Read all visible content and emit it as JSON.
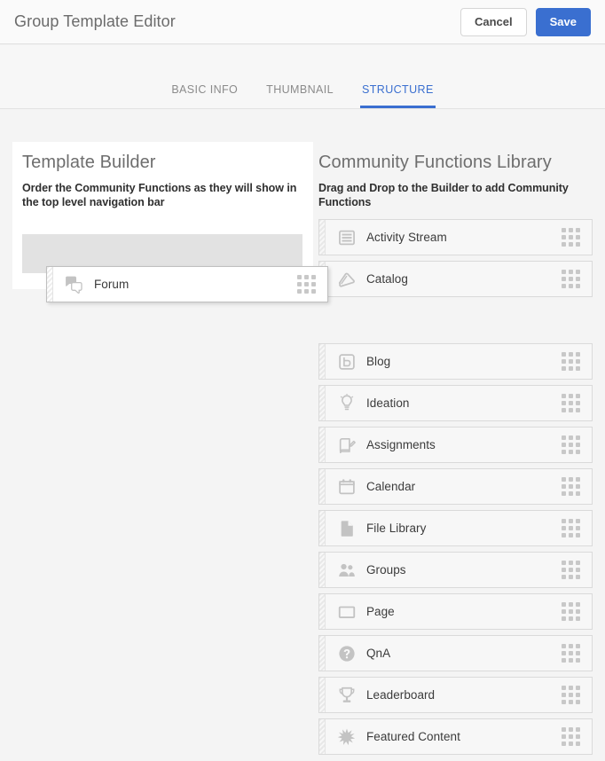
{
  "header": {
    "title": "Group Template Editor",
    "cancel_label": "Cancel",
    "save_label": "Save",
    "save_color": "#3a6fd0"
  },
  "tabs": [
    {
      "label": "BASIC INFO",
      "active": false
    },
    {
      "label": "THUMBNAIL",
      "active": false
    },
    {
      "label": "STRUCTURE",
      "active": true
    }
  ],
  "builder": {
    "title": "Template Builder",
    "description": "Order the Community Functions as they will show in the top level navigation bar",
    "placeholder_color": "#e2e2e2",
    "items": []
  },
  "library": {
    "title": "Community Functions Library",
    "description": "Drag and Drop to the Builder to add Community Functions",
    "items": [
      {
        "label": "Activity Stream",
        "icon": "activity-stream-icon",
        "gap_after": false
      },
      {
        "label": "Catalog",
        "icon": "catalog-icon",
        "gap_after": true
      },
      {
        "label": "Blog",
        "icon": "blog-icon",
        "gap_after": false
      },
      {
        "label": "Ideation",
        "icon": "lightbulb-icon",
        "gap_after": false
      },
      {
        "label": "Assignments",
        "icon": "assignments-icon",
        "gap_after": false
      },
      {
        "label": "Calendar",
        "icon": "calendar-icon",
        "gap_after": false
      },
      {
        "label": "File Library",
        "icon": "file-icon",
        "gap_after": false
      },
      {
        "label": "Groups",
        "icon": "groups-icon",
        "gap_after": false
      },
      {
        "label": "Page",
        "icon": "page-icon",
        "gap_after": false
      },
      {
        "label": "QnA",
        "icon": "question-circle-icon",
        "gap_after": false
      },
      {
        "label": "Leaderboard",
        "icon": "trophy-icon",
        "gap_after": false
      },
      {
        "label": "Featured Content",
        "icon": "starburst-icon",
        "gap_after": false
      }
    ]
  },
  "dragging_card": {
    "label": "Forum",
    "icon": "forum-icon"
  }
}
